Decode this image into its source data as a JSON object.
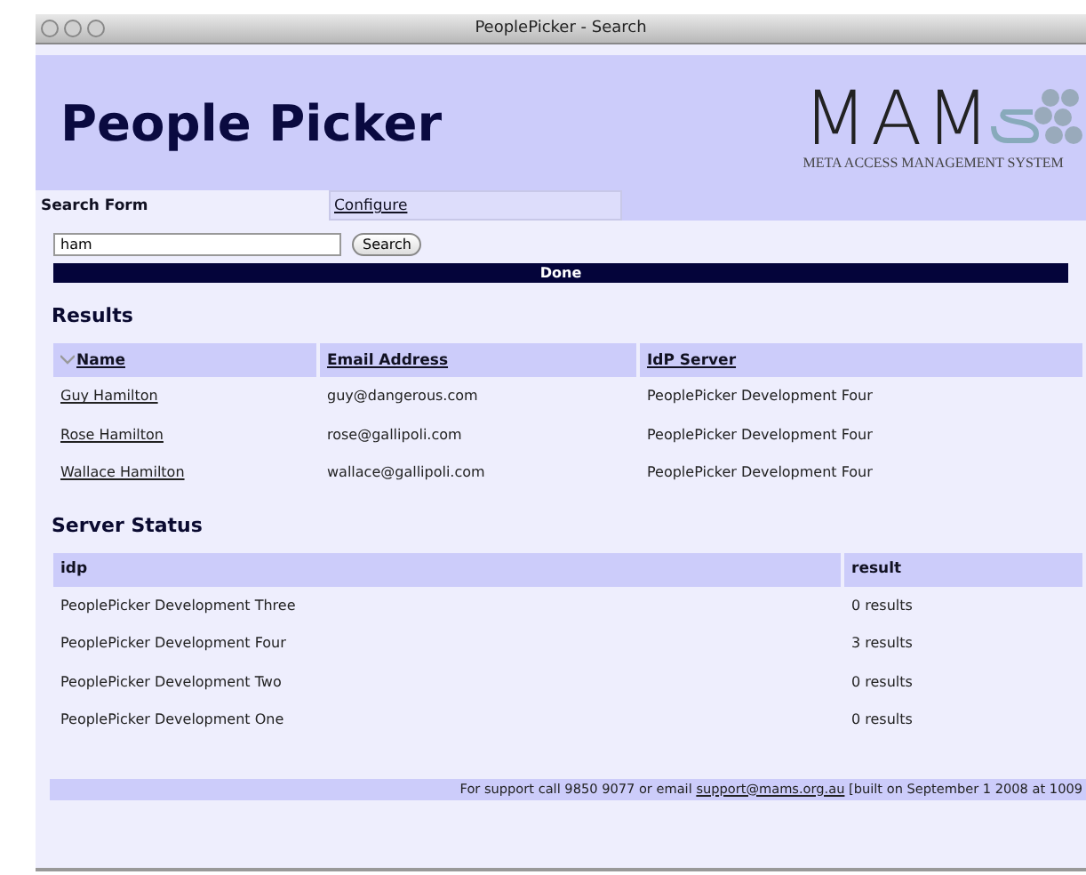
{
  "window": {
    "title": "PeoplePicker - Search"
  },
  "header": {
    "title": "People Picker",
    "logo_text": "MAM",
    "logo_subtitle": "META ACCESS MANAGEMENT SYSTEM"
  },
  "tabs": [
    {
      "label": "Search Form",
      "selected": true
    },
    {
      "label": "Configure",
      "selected": false
    }
  ],
  "search": {
    "value": "ham",
    "button": "Search",
    "status": "Done"
  },
  "results": {
    "title": "Results",
    "columns": [
      "Name",
      "Email Address",
      "IdP Server"
    ],
    "rows": [
      [
        "Guy Hamilton",
        "guy@dangerous.com",
        "PeoplePicker Development Four"
      ],
      [
        "Rose Hamilton",
        "rose@gallipoli.com",
        "PeoplePicker Development Four"
      ],
      [
        "Wallace Hamilton",
        "wallace@gallipoli.com",
        "PeoplePicker Development Four"
      ]
    ]
  },
  "server_status": {
    "title": "Server Status",
    "columns": [
      "idp",
      "result"
    ],
    "rows": [
      [
        "PeoplePicker Development Three",
        "0 results"
      ],
      [
        "PeoplePicker Development Four",
        "3 results"
      ],
      [
        "PeoplePicker Development Two",
        "0 results"
      ],
      [
        "PeoplePicker Development One",
        "0 results"
      ]
    ]
  },
  "footer": {
    "before": "For support call 9850 9077 or email ",
    "link": "support@mams.org.au",
    "after": " [built on September 1 2008 at 1009"
  }
}
